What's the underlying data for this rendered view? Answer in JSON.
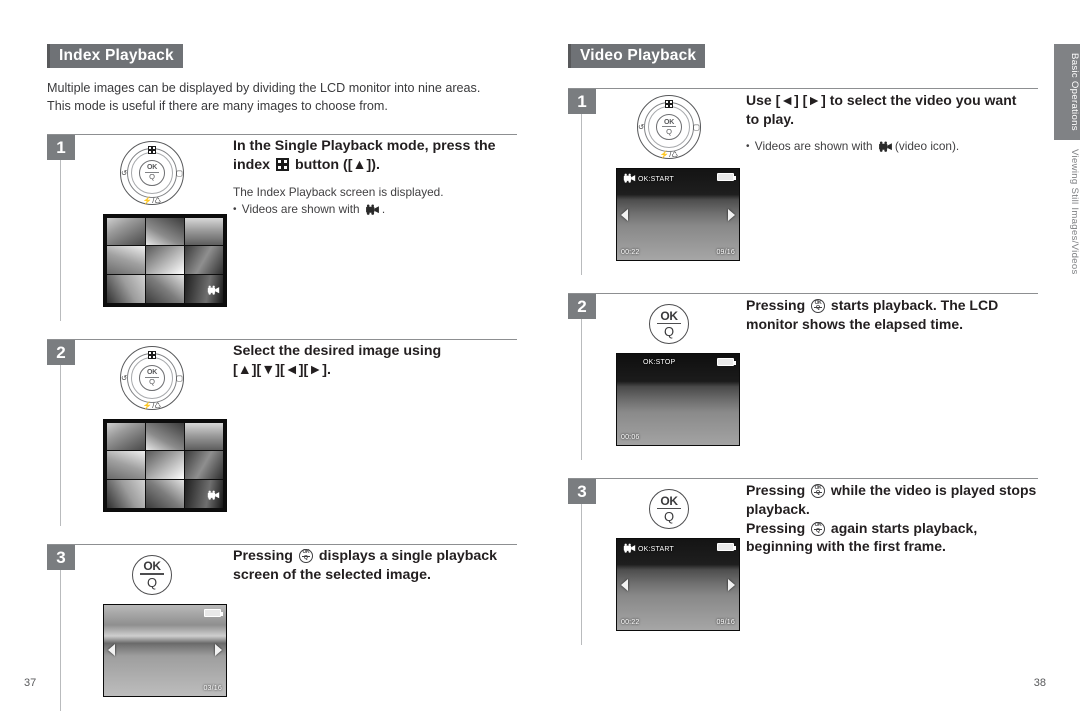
{
  "document": {
    "left_page_number": "37",
    "right_page_number": "38"
  },
  "side_tabs": [
    {
      "label": "Basic Operations",
      "active": true
    },
    {
      "label": "Viewing Still Images/Videos",
      "active": false
    }
  ],
  "left_column": {
    "heading": "Index Playback",
    "intro_line1": "Multiple images can be displayed by dividing the LCD monitor into nine areas.",
    "intro_line2": "This mode is useful if there are many images to choose from.",
    "steps": [
      {
        "number": "1",
        "headline_part1": "In the Single Playback mode, press the",
        "headline_part2": "index",
        "headline_part3": "button ([",
        "headline_part4": "]).",
        "arrow_up": "▲",
        "subtext_line1": "The Index Playback screen is displayed.",
        "subtext_line2": "Videos are shown with",
        "subtext_line2_end": ".",
        "control_icon": "four-way-controller",
        "screen": {
          "type": "index-grid",
          "video_cell_index": 8
        }
      },
      {
        "number": "2",
        "headline_part1": "Select the desired image using",
        "headline_part2": "[▲][▼][◄][►].",
        "control_icon": "four-way-controller",
        "screen": {
          "type": "index-grid",
          "video_cell_index": 8
        }
      },
      {
        "number": "3",
        "headline_part1": "Pressing",
        "headline_part2": "displays a single playback",
        "headline_part3": "screen of the selected image.",
        "control_icon": "ok-q-button",
        "screen": {
          "type": "single",
          "osd_bottom_right": "03/16",
          "battery": true,
          "arrows": true
        }
      }
    ]
  },
  "right_column": {
    "heading": "Video Playback",
    "steps": [
      {
        "number": "1",
        "headline_part1": "Use  [◄] [►]  to select the video you want",
        "headline_part2": "to play.",
        "subtext_line1": "Videos are shown with",
        "subtext_line1_end": "(video icon).",
        "control_icon": "four-way-controller",
        "screen": {
          "type": "video",
          "osd_top_left": "OK:START",
          "osd_bottom_left": "00:22",
          "osd_bottom_right": "09/16",
          "video_badge": true,
          "battery": true,
          "arrows": true
        }
      },
      {
        "number": "2",
        "headline_part1": "Pressing",
        "headline_part2": "starts playback. The LCD",
        "headline_part3": "monitor shows the elapsed time.",
        "control_icon": "ok-q-button",
        "screen": {
          "type": "video",
          "osd_top_left": "OK:STOP",
          "osd_bottom_left": "00:06",
          "osd_bottom_right": "",
          "video_badge": false,
          "battery": true,
          "arrows": false
        }
      },
      {
        "number": "3",
        "headline_part1": "Pressing",
        "headline_part2": "while the video is played stops",
        "headline_part3": "playback.",
        "headline_part4": "Pressing",
        "headline_part5": "again starts playback,",
        "headline_part6": "beginning with the first frame.",
        "control_icon": "ok-q-button",
        "screen": {
          "type": "video",
          "osd_top_left": "OK:START",
          "osd_bottom_left": "00:22",
          "osd_bottom_right": "09/16",
          "video_badge": true,
          "battery": true,
          "arrows": true
        }
      }
    ]
  },
  "colors": {
    "heading_bg": "#6f7276",
    "step_number_bg": "#7a7d80",
    "rule": "#8d8f91",
    "tab_active_bg": "#808285",
    "text": "#231f20"
  }
}
